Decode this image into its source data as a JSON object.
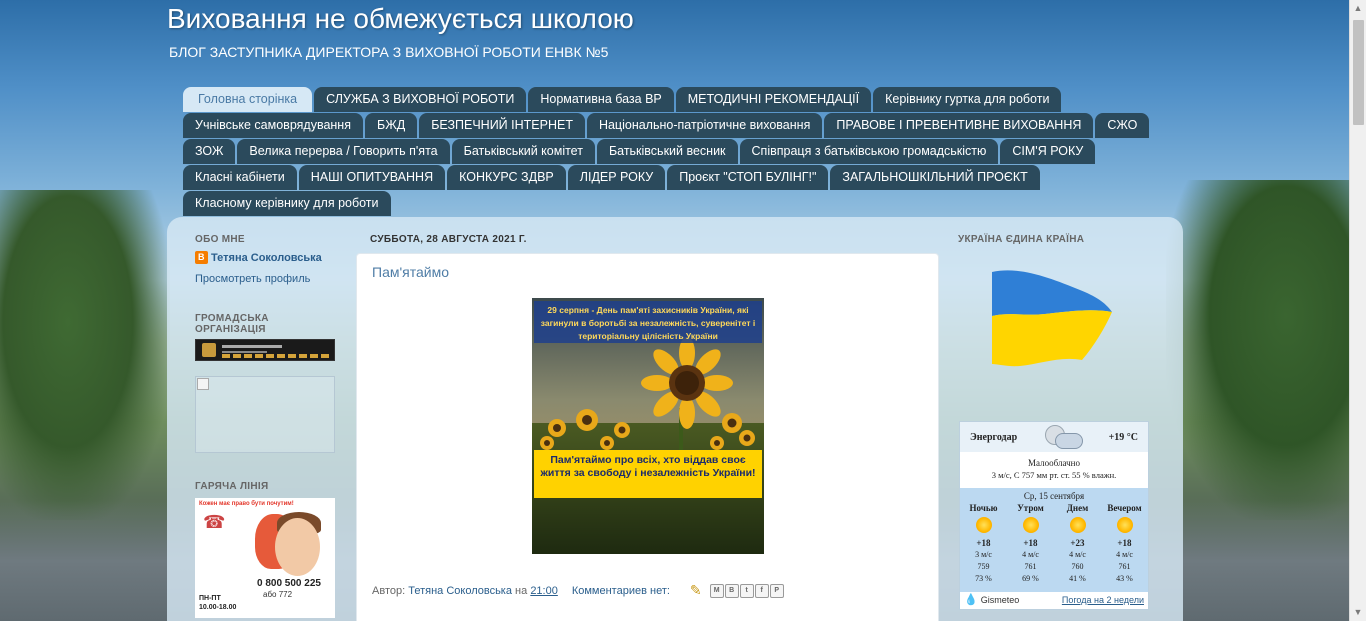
{
  "header": {
    "title": "Виховання не обмежується школою",
    "description": "БЛОГ ЗАСТУПНИКА ДИРЕКТОРА З ВИХОВНОЇ РОБОТИ ЕНВК №5"
  },
  "nav": {
    "rows": [
      [
        "Головна сторінка",
        "СЛУЖБА З ВИХОВНОЇ РОБОТИ",
        "Нормативна база ВР",
        "МЕТОДИЧНІ РЕКОМЕНДАЦІЇ",
        "Керівнику гуртка для роботи"
      ],
      [
        "Учнівське самоврядування",
        "БЖД",
        "БЕЗПЕЧНИЙ ІНТЕРНЕТ",
        "Національно-патріотичне виховання",
        "ПРАВОВЕ І ПРЕВЕНТИВНЕ ВИХОВАННЯ",
        "СЖО"
      ],
      [
        "ЗОЖ",
        "Велика перерва / Говорить п'ята",
        "Батьківський комітет",
        "Батьківський весник",
        "Співпраця з батьківською громадськістю",
        "СІМ'Я РОКУ"
      ],
      [
        "Класні кабінети",
        "НАШІ ОПИТУВАННЯ",
        "КОНКУРС ЗДВР",
        "ЛІДЕР РОКУ",
        "Проєкт \"СТОП БУЛІНГ!\"",
        "ЗАГАЛЬНОШКІЛЬНИЙ ПРОЄКТ"
      ],
      [
        "Класному керівнику для роботи"
      ]
    ]
  },
  "sidebar_left": {
    "about_title": "ОБО МНЕ",
    "profile_name": "Тетяна Соколовська",
    "profile_link": "Просмотреть профиль",
    "org_title": "ГРОМАДСЬКА ОРГАНІЗАЦІЯ",
    "hotline_title": "ГАРЯЧА ЛІНІЯ",
    "hotline": {
      "tagline": "Кожен має право бути почутим!",
      "number": "0 800 500 225",
      "alt": "або 772",
      "days": "ПН-ПТ",
      "hours": "10.00-18.00"
    }
  },
  "post": {
    "date": "СУББОТА, 28 АВГУСТА 2021 Г.",
    "title": "Пам'ятаймо",
    "image_top_text": "29 серпня - День пам'яті захисників України, які загинули в боротьбі за незалежність, суверенітет і територіальну цілісність України",
    "image_bottom_text": "Пам'ятаймо про всіх, хто віддав своє життя за свободу і незалежність України!",
    "author_label": "Автор:",
    "author": "Тетяна Соколовська",
    "at_label": "на",
    "time": "21:00",
    "comments": "Комментариев нет:",
    "share_buttons": [
      "M",
      "B",
      "t",
      "f",
      "P"
    ]
  },
  "sidebar_right": {
    "title": "УКРАЇНА ЄДИНА КРАЇНА",
    "flag_colors": [
      "#2f7fd6",
      "#ffd500"
    ],
    "weather": {
      "city": "Энергодар",
      "temp": "+19 °C",
      "condition": "Малооблачно",
      "stats": "3 м/с, С   757 мм рт. ст.   55 % влажн.",
      "date": "Ср, 15 сентября",
      "columns": [
        {
          "label": "Ночью",
          "temp": "+18",
          "wind": "3 м/с",
          "pressure": "759",
          "humidity": "73 %"
        },
        {
          "label": "Утром",
          "temp": "+18",
          "wind": "4 м/с",
          "pressure": "761",
          "humidity": "69 %"
        },
        {
          "label": "Днем",
          "temp": "+23",
          "wind": "4 м/с",
          "pressure": "760",
          "humidity": "41 %"
        },
        {
          "label": "Вечером",
          "temp": "+18",
          "wind": "4 м/с",
          "pressure": "761",
          "humidity": "43 %"
        }
      ],
      "brand": "Gismeteo",
      "two_weeks_link": "Погода на 2 недели"
    }
  }
}
